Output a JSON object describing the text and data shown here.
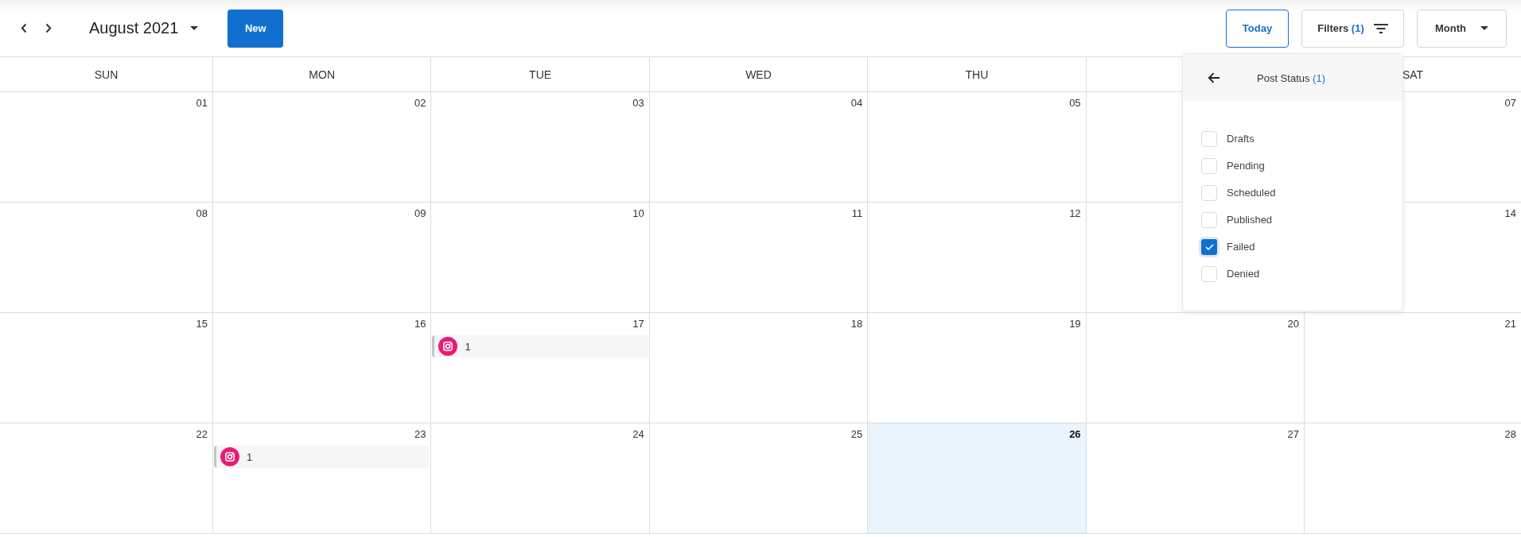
{
  "toolbar": {
    "period": "August 2021",
    "new_button": "New",
    "today_button": "Today",
    "filters_button": {
      "label": "Filters",
      "count": "(1)"
    },
    "view_button": "Month"
  },
  "weekdays": [
    "SUN",
    "MON",
    "TUE",
    "WED",
    "THU",
    "SAT"
  ],
  "weeks": [
    {
      "days": [
        {
          "day": "01",
          "today": false
        },
        {
          "day": "02",
          "today": false
        },
        {
          "day": "03",
          "today": false
        },
        {
          "day": "04",
          "today": false
        },
        {
          "day": "05",
          "today": false
        },
        {
          "today": false
        },
        {
          "day": "07",
          "today": false
        }
      ]
    },
    {
      "days": [
        {
          "day": "08",
          "today": false
        },
        {
          "day": "09",
          "today": false
        },
        {
          "day": "10",
          "today": false
        },
        {
          "day": "11",
          "today": false
        },
        {
          "day": "12",
          "today": false
        },
        {
          "today": false
        },
        {
          "day": "14",
          "today": false
        }
      ]
    },
    {
      "days": [
        {
          "day": "15",
          "today": false
        },
        {
          "day": "16",
          "today": false
        },
        {
          "day": "17",
          "today": false,
          "events": [
            {
              "count": "1"
            }
          ]
        },
        {
          "day": "18",
          "today": false
        },
        {
          "day": "19",
          "today": false
        },
        {
          "day": "20",
          "today": false
        },
        {
          "day": "21",
          "today": false
        }
      ]
    },
    {
      "days": [
        {
          "day": "22",
          "today": false
        },
        {
          "day": "23",
          "today": false,
          "events": [
            {
              "count": "1"
            }
          ]
        },
        {
          "day": "24",
          "today": false
        },
        {
          "day": "25",
          "today": false
        },
        {
          "day": "26",
          "today": true
        },
        {
          "day": "27",
          "today": false
        },
        {
          "day": "28",
          "today": false
        }
      ]
    }
  ],
  "filter_menu": {
    "title": "Post Status",
    "count": "(1)",
    "options": [
      {
        "label": "Drafts",
        "checked": false
      },
      {
        "label": "Pending",
        "checked": false
      },
      {
        "label": "Scheduled",
        "checked": false
      },
      {
        "label": "Published",
        "checked": false
      },
      {
        "label": "Failed",
        "checked": true
      },
      {
        "label": "Denied",
        "checked": false
      }
    ]
  }
}
